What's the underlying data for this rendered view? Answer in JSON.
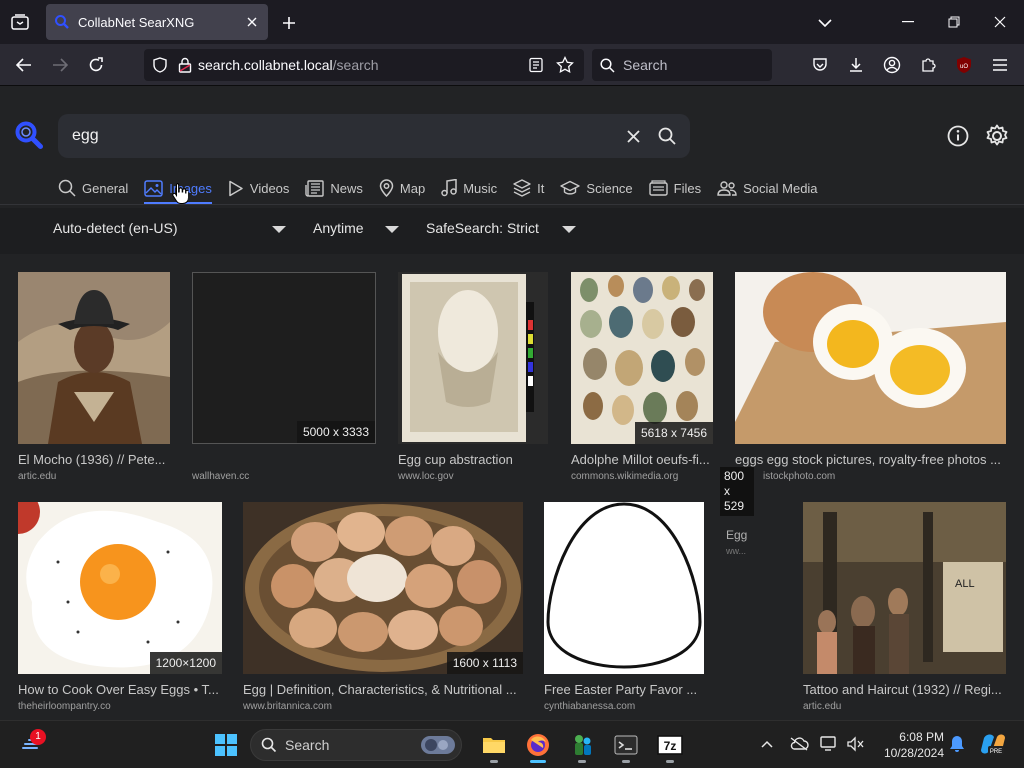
{
  "browser": {
    "tab": {
      "title": "CollabNet SearXNG"
    },
    "url": {
      "host": "search.collabnet.local",
      "path": "/search"
    },
    "web_search": {
      "placeholder": "Search"
    }
  },
  "search": {
    "query": "egg",
    "categories": [
      {
        "label": "General",
        "icon": "search-icon"
      },
      {
        "label": "Images",
        "icon": "image-icon",
        "active": true
      },
      {
        "label": "Videos",
        "icon": "play-icon"
      },
      {
        "label": "News",
        "icon": "newspaper-icon"
      },
      {
        "label": "Map",
        "icon": "map-pin-icon"
      },
      {
        "label": "Music",
        "icon": "music-note-icon"
      },
      {
        "label": "It",
        "icon": "layers-icon"
      },
      {
        "label": "Science",
        "icon": "graduation-cap-icon"
      },
      {
        "label": "Files",
        "icon": "files-icon"
      },
      {
        "label": "Social Media",
        "icon": "people-icon"
      }
    ],
    "filters": {
      "language": "Auto-detect (en-US)",
      "time": "Anytime",
      "safesearch": "SafeSearch: Strict"
    }
  },
  "results": [
    {
      "title": "El Mocho (1936) // Pete...",
      "url": "artic.edu",
      "dim": ""
    },
    {
      "title": "",
      "url": "wallhaven.cc",
      "dim": "5000 x 3333"
    },
    {
      "title": "Egg cup abstraction",
      "url": "www.loc.gov",
      "dim": ""
    },
    {
      "title": "Adolphe Millot oeufs-fi...",
      "url": "commons.wikimedia.org",
      "dim": "5618 x 7456"
    },
    {
      "title": "eggs egg stock pictures, royalty-free photos ...",
      "url": "istockphoto.com",
      "dim": ""
    },
    {
      "title": "How to Cook Over Easy Eggs • T...",
      "url": "theheirloompantry.co",
      "dim": "1200×1200"
    },
    {
      "title": "Egg | Definition, Characteristics, & Nutritional ...",
      "url": "www.britannica.com",
      "dim": "1600 x 1113"
    },
    {
      "title": "Free Easter Party Favor ...",
      "url": "cynthiabanessa.com",
      "dim": ""
    },
    {
      "title": "Tattoo and Haircut (1932) // Regi...",
      "url": "artic.edu",
      "dim": ""
    }
  ],
  "floating": {
    "dim": "800 x 529",
    "title": "Egg",
    "url": "ww..."
  },
  "taskbar": {
    "search_label": "Search",
    "notification_count": "1",
    "time": "6:08 PM",
    "date": "10/28/2024"
  },
  "colors": {
    "accent": "#4f7cff",
    "page_bg": "#222325",
    "chrome_bg": "#2b2a33"
  }
}
